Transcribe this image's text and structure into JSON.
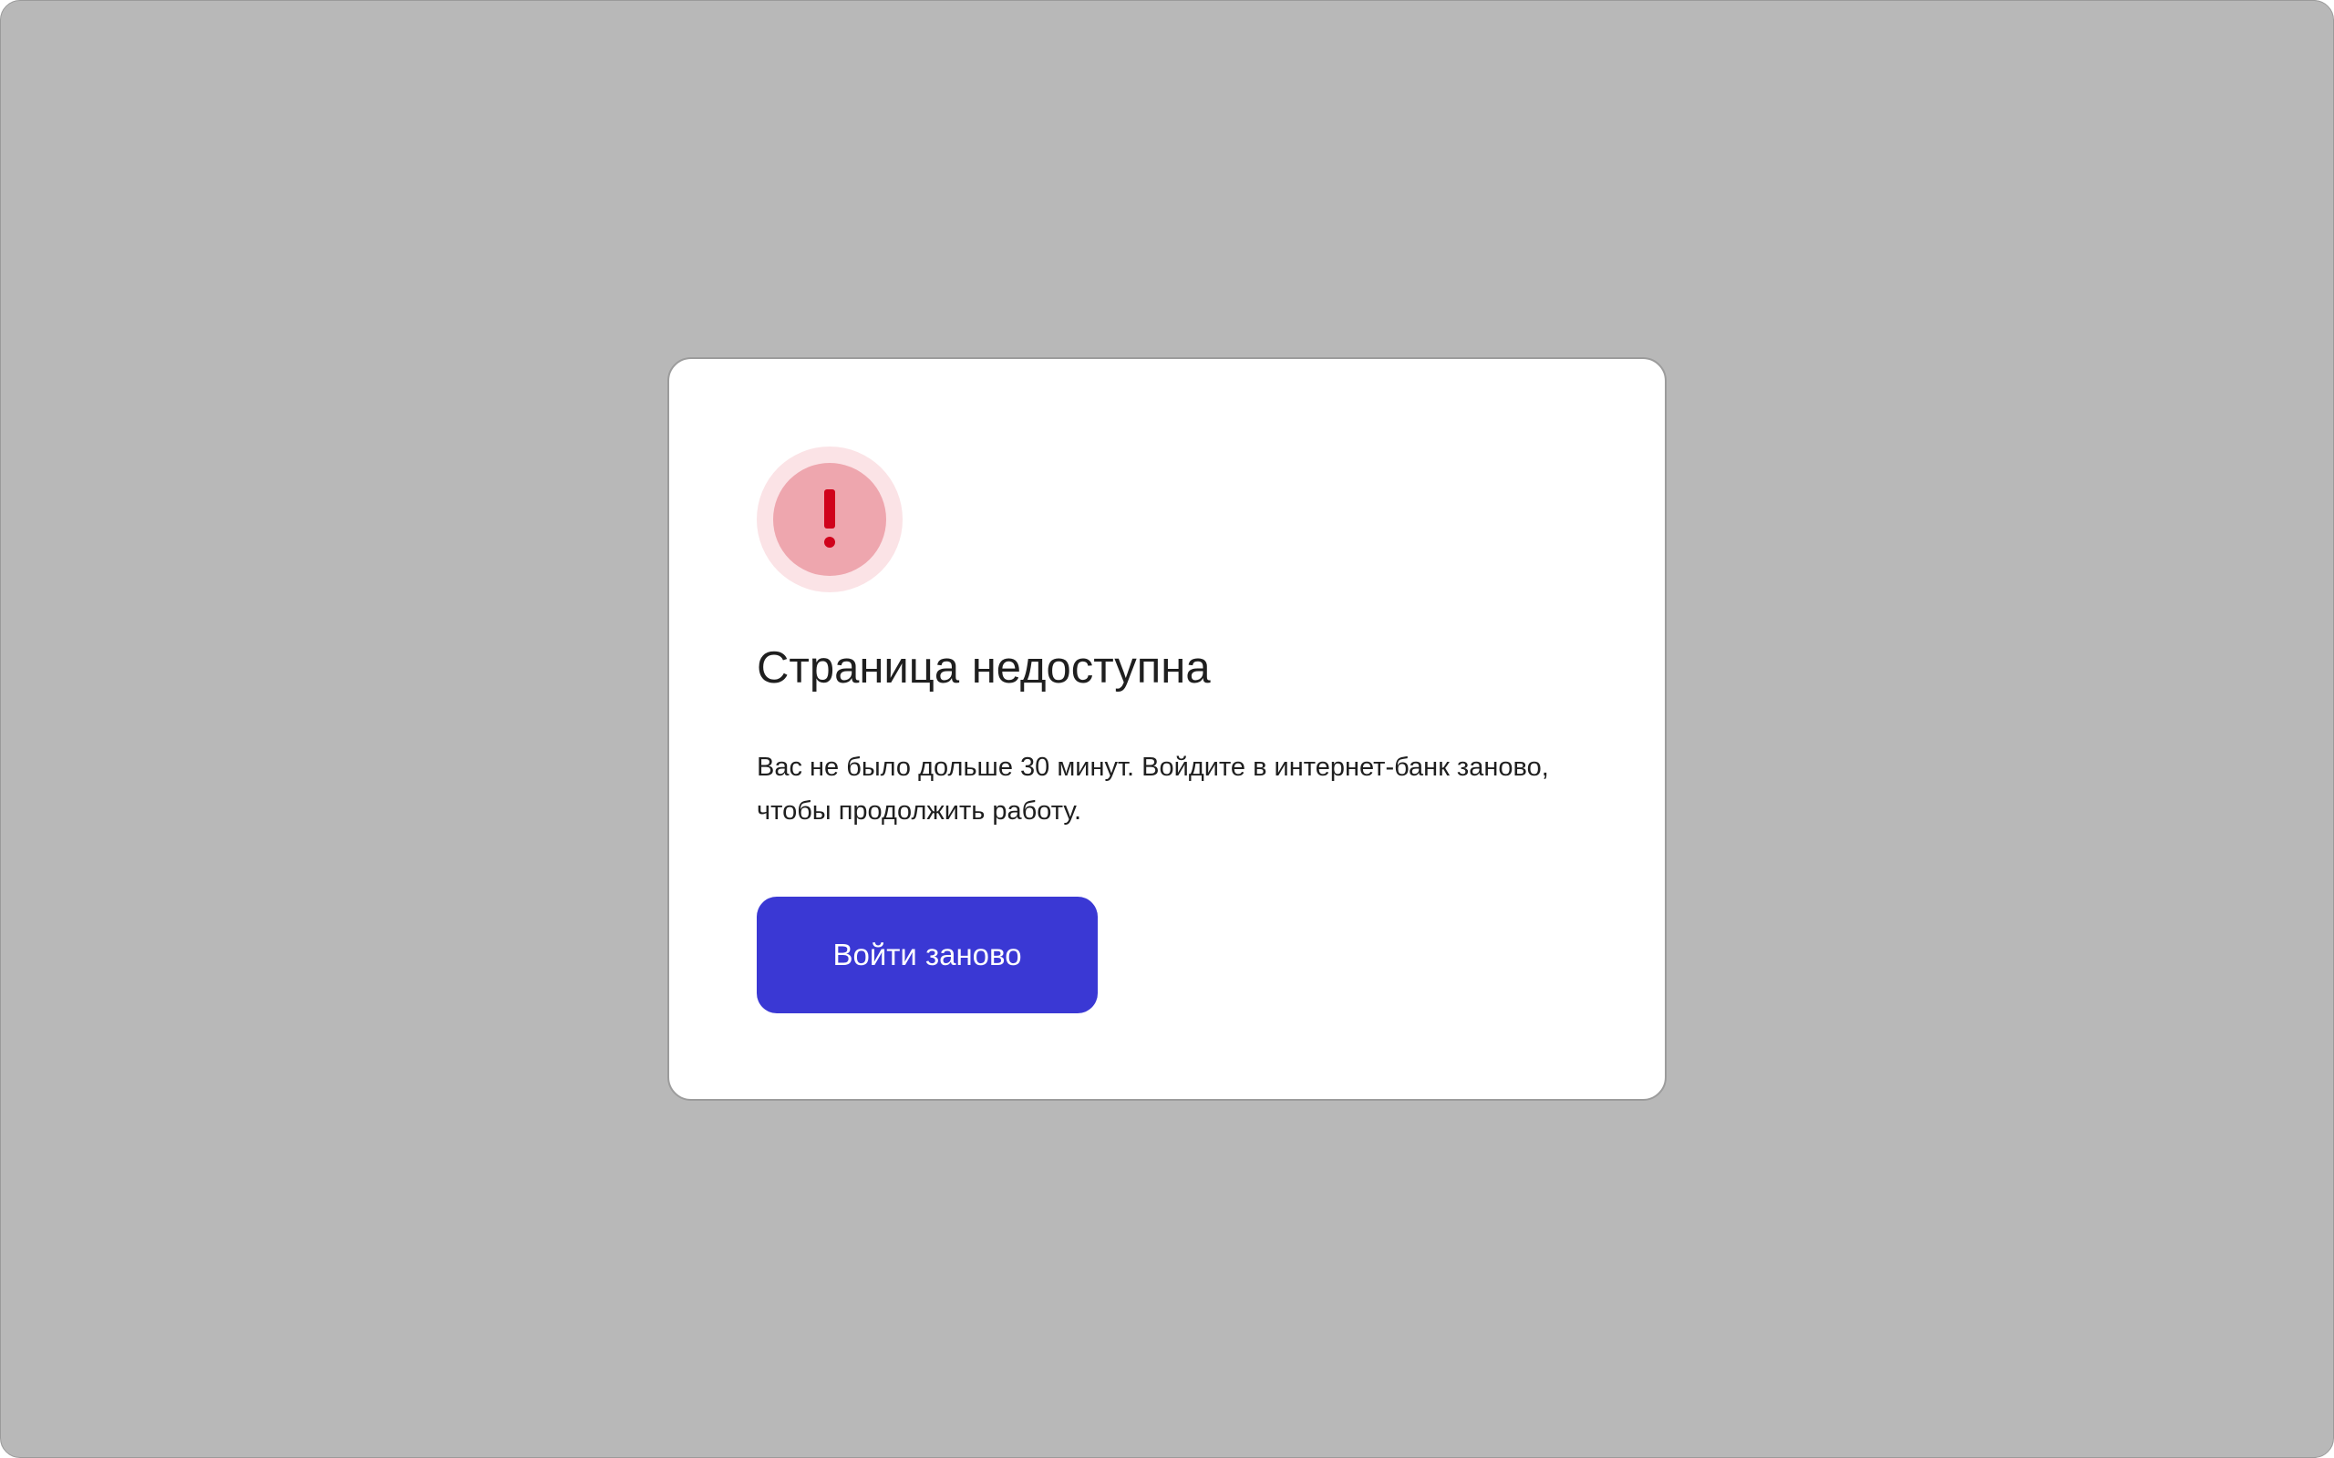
{
  "dialog": {
    "icon": "exclamation-icon",
    "title": "Страница недоступна",
    "message": "Вас не было дольше 30 минут. Войдите в интернет-банк заново, чтобы продолжить работу.",
    "button_label": "Войти заново"
  },
  "colors": {
    "backdrop": "#b8b8b8",
    "icon_outer": "#fbe3e6",
    "icon_inner": "#eea6ae",
    "icon_glyph": "#d0021b",
    "button": "#3a38d4",
    "text": "#1f1f1f"
  }
}
